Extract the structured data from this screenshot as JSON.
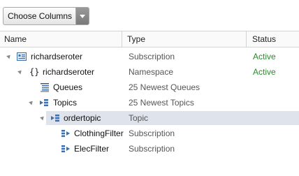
{
  "toolbar": {
    "choose_columns_label": "Choose Columns"
  },
  "columns": {
    "name": "Name",
    "type": "Type",
    "status": "Status"
  },
  "rows": [
    {
      "name": "richardseroter",
      "type": "Subscription",
      "status": "Active",
      "icon": "subscription-card-icon"
    },
    {
      "name": "richardseroter",
      "type": "Namespace",
      "status": "Active",
      "icon": "namespace-braces-icon"
    },
    {
      "name": "Queues",
      "type": "25 Newest Queues",
      "status": "",
      "icon": "queues-icon"
    },
    {
      "name": "Topics",
      "type": "25 Newest Topics",
      "status": "",
      "icon": "topics-icon"
    },
    {
      "name": "ordertopic",
      "type": "Topic",
      "status": "",
      "icon": "topic-icon"
    },
    {
      "name": "ClothingFilter",
      "type": "Subscription",
      "status": "",
      "icon": "filter-subscription-icon"
    },
    {
      "name": "ElecFilter",
      "type": "Subscription",
      "status": "",
      "icon": "filter-subscription-icon"
    }
  ],
  "colors": {
    "status_active": "#2a8a2a",
    "selected_row": "#dfe4ec"
  }
}
